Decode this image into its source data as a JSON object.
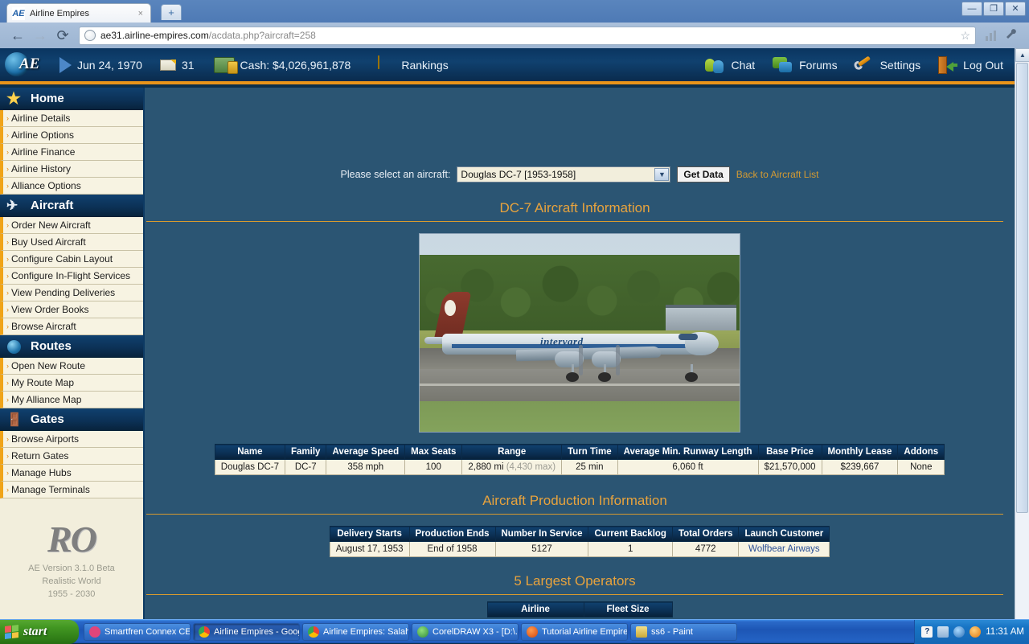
{
  "browser": {
    "tab_title": "Airline Empires",
    "tab_favicon": "AE",
    "tab_close": "×",
    "new_tab": "+",
    "back_icon": "←",
    "forward_icon": "→",
    "reload_icon": "⟳",
    "url_host": "ae31.airline-empires.com",
    "url_path": "/acdata.php?aircraft=258",
    "star_icon": "☆",
    "minimize": "—",
    "maximize": "❐",
    "close": "✕"
  },
  "topbar": {
    "logo_text": "AE",
    "date": "Jun 24, 1970",
    "messages": "31",
    "cash": "Cash: $4,026,961,878",
    "rankings": "Rankings",
    "chat": "Chat",
    "forums": "Forums",
    "settings": "Settings",
    "logout": "Log Out"
  },
  "sidebar": {
    "sections": [
      {
        "title": "Home",
        "icon": "star-icon",
        "items": [
          "Airline Details",
          "Airline Options",
          "Airline Finance",
          "Airline History",
          "Alliance Options"
        ]
      },
      {
        "title": "Aircraft",
        "icon": "plane-icon",
        "items": [
          "Order New Aircraft",
          "Buy Used Aircraft",
          "Configure Cabin Layout",
          "Configure In-Flight Services",
          "View Pending Deliveries",
          "View Order Books",
          "Browse Aircraft"
        ]
      },
      {
        "title": "Routes",
        "icon": "globe-icon",
        "items": [
          "Open New Route",
          "My Route Map",
          "My Alliance Map"
        ]
      },
      {
        "title": "Gates",
        "icon": "gate-icon",
        "items": [
          "Browse Airports",
          "Return Gates",
          "Manage Hubs",
          "Manage Terminals"
        ]
      }
    ],
    "chevron": "›",
    "footer": {
      "logo": "RO",
      "version": "AE Version 3.1.0 Beta",
      "world": "Realistic World",
      "years": "1955 - 2030"
    }
  },
  "main": {
    "select_label": "Please select an aircraft:",
    "selected_aircraft": "Douglas DC-7 [1953-1958]",
    "dropdown_arrow": "▼",
    "get_data_label": "Get Data",
    "back_link": "Back to Aircraft List",
    "section_title_1": "DC-7 Aircraft Information",
    "section_title_2": "Aircraft Production Information",
    "section_title_3": "5 Largest Operators",
    "photo_livery": "intervard",
    "spec_table": {
      "headers": [
        "Name",
        "Family",
        "Average Speed",
        "Max Seats",
        "Range",
        "Turn Time",
        "Average Min. Runway Length",
        "Base Price",
        "Monthly Lease",
        "Addons"
      ],
      "row": {
        "name": "Douglas DC-7",
        "family": "DC-7",
        "average_speed": "358 mph",
        "max_seats": "100",
        "range": "2,880 mi",
        "range_max": "(4,430 max)",
        "turn_time": "25 min",
        "runway_length": "6,060 ft",
        "base_price": "$21,570,000",
        "monthly_lease": "$239,667",
        "addons": "None"
      }
    },
    "production_table": {
      "headers": [
        "Delivery Starts",
        "Production Ends",
        "Number In Service",
        "Current Backlog",
        "Total Orders",
        "Launch Customer"
      ],
      "row": {
        "delivery_starts": "August 17, 1953",
        "production_ends": "End of 1958",
        "number_in_service": "5127",
        "current_backlog": "1",
        "total_orders": "4772",
        "launch_customer": "Wolfbear Airways"
      }
    },
    "operators_table": {
      "headers": [
        "Airline",
        "Fleet Size"
      ]
    }
  },
  "taskbar": {
    "start_label": "start",
    "items": [
      {
        "label": "Smartfren Connex CE...",
        "color": "#e0457b",
        "active": false
      },
      {
        "label": "Airline Empires - Goog...",
        "color": "#f2a32c",
        "active": true
      },
      {
        "label": "Airline Empires: Salah...",
        "color": "#f2a32c",
        "active": false
      },
      {
        "label": "CorelDRAW X3 - [D:\\...",
        "color": "#3da34b",
        "active": false
      },
      {
        "label": "Tutorial Airline Empire...",
        "color": "#e8732a",
        "active": false
      },
      {
        "label": "ss6 - Paint",
        "color": "#d9c45a",
        "active": false
      }
    ],
    "clock": "11:31 AM",
    "tray_icons": [
      "help-icon",
      "network-icon",
      "shield-icon",
      "update-icon"
    ]
  }
}
